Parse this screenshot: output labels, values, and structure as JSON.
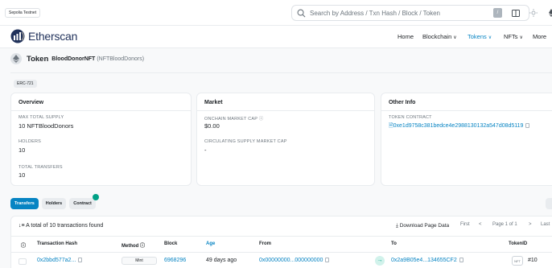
{
  "topbar": {
    "network": "Sepolia Testnet",
    "search_placeholder": "Search by Address / Txn Hash / Block / Token",
    "slash_key": "/"
  },
  "header": {
    "brand": "Etherscan",
    "nav": [
      {
        "label": "Home"
      },
      {
        "label": "Blockchain"
      },
      {
        "label": "Tokens"
      },
      {
        "label": "NFTs"
      },
      {
        "label": "More"
      }
    ]
  },
  "token": {
    "label": "Token",
    "name": "BloodDonorNFT",
    "symbol": "(NFTBloodDonors)",
    "standard": "ERC-721"
  },
  "overview": {
    "title": "Overview",
    "max_supply_label": "MAX TOTAL SUPPLY",
    "max_supply_value": "10 NFTBloodDonors",
    "holders_label": "HOLDERS",
    "holders_value": "10",
    "transfers_label": "TOTAL TRANSFERS",
    "transfers_value": "10"
  },
  "market": {
    "title": "Market",
    "mcap_label": "ONCHAIN MARKET CAP",
    "mcap_value": "$0.00",
    "circ_label": "CIRCULATING SUPPLY MARKET CAP",
    "circ_value": "-"
  },
  "other_info": {
    "title": "Other Info",
    "contract_label": "TOKEN CONTRACT",
    "contract_value": "0xe1d9758c381bedce4e2988130132a547d08d5119"
  },
  "tabs": [
    {
      "label": "Transfers",
      "active": true
    },
    {
      "label": "Holders",
      "active": false
    },
    {
      "label": "Contract",
      "active": false
    }
  ],
  "transactions": {
    "summary": "A total of 10 transactions found",
    "download": "Download Page Data",
    "pager": {
      "first": "First",
      "prev": "<",
      "page": "Page 1 of 1",
      "next": ">",
      "last": "Last"
    },
    "headers": {
      "hash": "Transaction Hash",
      "method": "Method",
      "block": "Block",
      "age": "Age",
      "from": "From",
      "to": "To",
      "token_id": "TokenID"
    },
    "rows": [
      {
        "hash": "0x2bbd577a2...",
        "method": "Mint",
        "block": "6968296",
        "age": "49 days ago",
        "from": "0x00000000...000000000",
        "to": "0x2a9B05e4...134655CF2",
        "token_id": "#10"
      }
    ]
  },
  "colors": {
    "accent": "#0784c3",
    "brand_navy": "#21325b",
    "success": "#00a186"
  },
  "icons": {
    "search": "search-icon",
    "theme": "sun-icon",
    "wallet": "wallet-icon",
    "info": "info-icon",
    "copy": "copy-icon",
    "eye": "eye-icon",
    "filter": "sort-icon",
    "download": "download-icon"
  }
}
